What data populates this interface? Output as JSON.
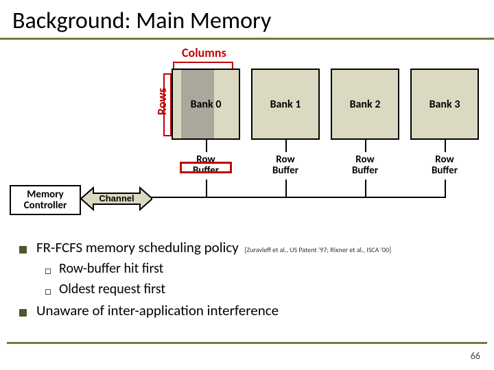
{
  "title": "Background: Main Memory",
  "diagram": {
    "columns_label": "Columns",
    "rows_label": "Rows",
    "banks": [
      "Bank 0",
      "Bank 1",
      "Bank 2",
      "Bank 3"
    ],
    "row_buffer_label_line1": "Row",
    "row_buffer_label_line2": "Buffer",
    "memory_controller": "Memory Controller",
    "channel": "Channel"
  },
  "bullets": {
    "b1_text": "FR-FCFS memory scheduling policy",
    "b1_cite": "[Zuravleff et al., US Patent '97; Rixner et al., ISCA '00]",
    "b1a": "Row-buffer hit first",
    "b1b": "Oldest request first",
    "b2": "Unaware of inter-application interference"
  },
  "page_number": "66"
}
